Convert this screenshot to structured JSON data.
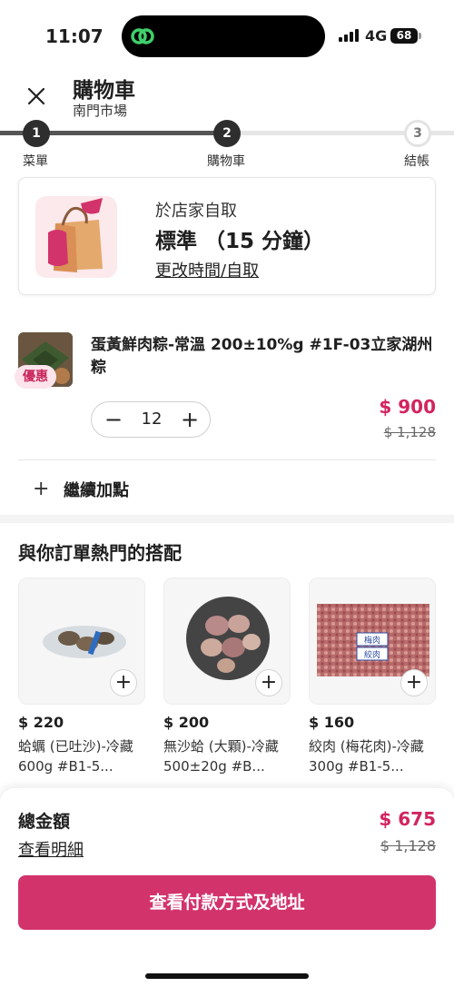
{
  "status_bar": {
    "time": "11:07",
    "network": "4G",
    "battery": "68"
  },
  "header": {
    "title": "購物車",
    "subtitle": "南門市場"
  },
  "stepper": [
    {
      "num": "1",
      "label": "菜單"
    },
    {
      "num": "2",
      "label": "購物車"
    },
    {
      "num": "3",
      "label": "結帳"
    }
  ],
  "pickup": {
    "mode": "於店家自取",
    "eta": "標準 （15 分鐘）",
    "change_link": "更改時間/自取"
  },
  "cart_item": {
    "badge": "優惠",
    "name": "蛋黃鮮肉粽-常溫 200±10%g #1F-03立家湖州粽",
    "quantity": "12",
    "price": "$ 900",
    "original_price": "$ 1,128"
  },
  "add_more": {
    "icon": "+",
    "label": "繼續加點"
  },
  "recommendations": {
    "title": "與你訂單熱門的搭配",
    "items": [
      {
        "price": "$ 220",
        "name": "蛤蠣 (已吐沙)-冷藏 600g #B1-5..."
      },
      {
        "price": "$ 200",
        "name": "無沙蛤 (大顆)-冷藏 500±20g #B..."
      },
      {
        "price": "$ 160",
        "name": "絞肉 (梅花肉)-冷藏 300g #B1-5...",
        "pack_label_1": "梅肉",
        "pack_label_2": "絞肉"
      }
    ]
  },
  "summary": {
    "total_label": "總金額",
    "detail_link": "查看明細",
    "total": "$ 675",
    "original_total": "$ 1,128",
    "checkout_label": "查看付款方式及地址"
  },
  "colors": {
    "accent": "#d2336b",
    "price": "#d2245f",
    "badge_bg": "#fbe4ec"
  }
}
